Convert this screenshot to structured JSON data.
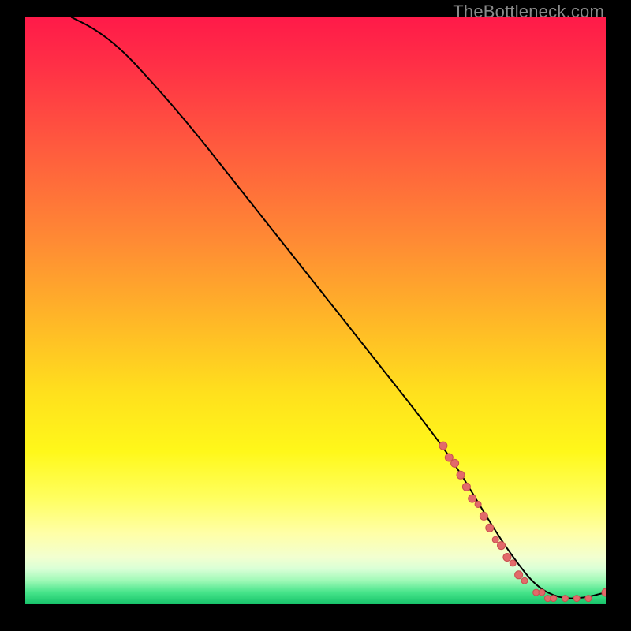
{
  "watermark": "TheBottleneck.com",
  "chart_data": {
    "type": "line",
    "title": "",
    "xlabel": "",
    "ylabel": "",
    "xlim": [
      0,
      100
    ],
    "ylim": [
      0,
      100
    ],
    "grid": false,
    "background": "rainbow-vertical",
    "curve": {
      "name": "bottleneck-curve",
      "x": [
        8,
        12,
        16,
        20,
        28,
        36,
        44,
        52,
        60,
        68,
        74,
        80,
        84,
        88,
        92,
        96,
        100
      ],
      "y": [
        100,
        98,
        95,
        91,
        82,
        72,
        62,
        52,
        42,
        32,
        24,
        14,
        8,
        3,
        1,
        1,
        2
      ]
    },
    "scatter_cluster": {
      "name": "highlight-points",
      "points": [
        {
          "x": 72,
          "y": 27,
          "r": 5
        },
        {
          "x": 73,
          "y": 25,
          "r": 5
        },
        {
          "x": 74,
          "y": 24,
          "r": 5
        },
        {
          "x": 75,
          "y": 22,
          "r": 5
        },
        {
          "x": 76,
          "y": 20,
          "r": 5
        },
        {
          "x": 77,
          "y": 18,
          "r": 5
        },
        {
          "x": 78,
          "y": 17,
          "r": 4
        },
        {
          "x": 79,
          "y": 15,
          "r": 5
        },
        {
          "x": 80,
          "y": 13,
          "r": 5
        },
        {
          "x": 81,
          "y": 11,
          "r": 4
        },
        {
          "x": 82,
          "y": 10,
          "r": 5
        },
        {
          "x": 83,
          "y": 8,
          "r": 5
        },
        {
          "x": 84,
          "y": 7,
          "r": 4
        },
        {
          "x": 85,
          "y": 5,
          "r": 5
        },
        {
          "x": 86,
          "y": 4,
          "r": 4
        },
        {
          "x": 88,
          "y": 2,
          "r": 4
        },
        {
          "x": 89,
          "y": 2,
          "r": 4
        },
        {
          "x": 90,
          "y": 1,
          "r": 4
        },
        {
          "x": 91,
          "y": 1,
          "r": 4
        },
        {
          "x": 93,
          "y": 1,
          "r": 4
        },
        {
          "x": 95,
          "y": 1,
          "r": 4
        },
        {
          "x": 97,
          "y": 1,
          "r": 4
        },
        {
          "x": 100,
          "y": 2,
          "r": 5
        }
      ]
    }
  }
}
